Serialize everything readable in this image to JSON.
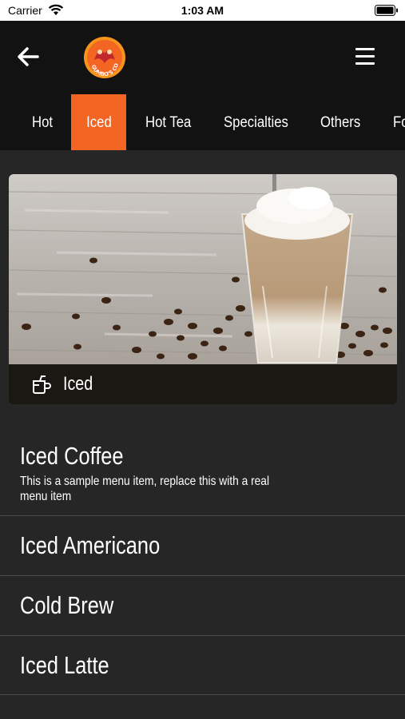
{
  "status_bar": {
    "carrier": "Carrier",
    "time": "1:03 AM"
  },
  "header": {
    "logo_text": "GUMBO'S COFFEE",
    "back_icon": "back-arrow-icon",
    "menu_icon": "hamburger-menu-icon"
  },
  "tabs": [
    {
      "label": "Hot"
    },
    {
      "label": "Iced",
      "active": true
    },
    {
      "label": "Hot Tea"
    },
    {
      "label": "Specialties"
    },
    {
      "label": "Others"
    },
    {
      "label": "Fo"
    }
  ],
  "banner": {
    "title": "Iced",
    "icon": "cup-icon"
  },
  "menu_items": [
    {
      "name": "Iced Coffee",
      "description": "This is a sample menu item, replace this with a real menu item"
    },
    {
      "name": "Iced Americano"
    },
    {
      "name": "Cold Brew"
    },
    {
      "name": "Iced Latte"
    }
  ],
  "colors": {
    "accent": "#f26522",
    "navbar": "#121212",
    "background": "#262626",
    "logo": "#f7941d"
  }
}
